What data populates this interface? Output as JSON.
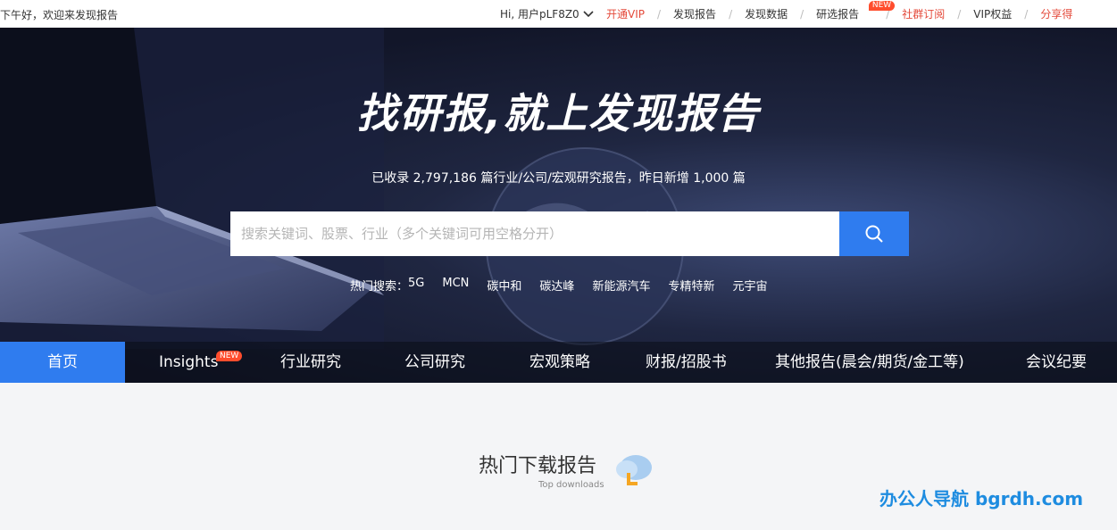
{
  "topbar": {
    "greeting": "下午好，欢迎来发现报告",
    "user": "Hi, 用户pLF8Z0",
    "nav": [
      {
        "label": "开通VIP",
        "red": true
      },
      {
        "label": "发现报告",
        "red": false
      },
      {
        "label": "发现数据",
        "red": false
      },
      {
        "label": "研选报告",
        "red": false,
        "badge": "NEW"
      },
      {
        "label": "社群订阅",
        "red": true
      },
      {
        "label": "VIP权益",
        "red": false
      },
      {
        "label": "分享得",
        "red": true
      }
    ]
  },
  "hero": {
    "headline": "找研报,就上发现报告",
    "stats": "已收录 2,797,186 篇行业/公司/宏观研究报告，昨日新增 1,000 篇",
    "search_placeholder": "搜索关键词、股票、行业（多个关键词可用空格分开）",
    "hot_label": "热门搜索：",
    "hot_terms": [
      "5G",
      "MCN",
      "碳中和",
      "碳达峰",
      "新能源汽车",
      "专精特新",
      "元宇宙"
    ]
  },
  "catnav": {
    "items": [
      "首页",
      "Insights",
      "行业研究",
      "公司研究",
      "宏观策略",
      "财报/招股书",
      "其他报告(晨会/期货/金工等)",
      "会议纪要"
    ],
    "insights_badge": "NEW"
  },
  "section": {
    "title": "热门下载报告",
    "subtitle": "Top downloads"
  },
  "watermark": "办公人导航  bgrdh.com",
  "colors": {
    "accent": "#2f7cef",
    "red": "#e4493a",
    "badge": "#ff4d2d"
  }
}
